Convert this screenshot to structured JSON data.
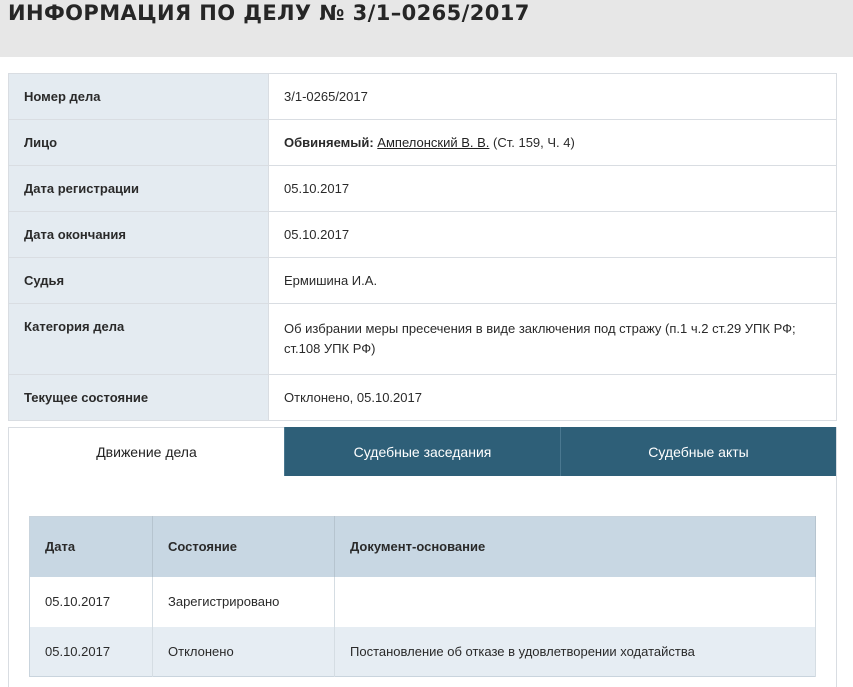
{
  "header": {
    "title": "Информация по делу № 3/1–0265/2017"
  },
  "case_info": {
    "rows": [
      {
        "label": "Номер дела",
        "value": "3/1-0265/2017"
      },
      {
        "label": "Лицо",
        "role": "Обвиняемый:",
        "name": "Ампелонский В. В.",
        "extra": "(Ст. 159, Ч. 4)"
      },
      {
        "label": "Дата регистрации",
        "value": "05.10.2017"
      },
      {
        "label": "Дата окончания",
        "value": "05.10.2017"
      },
      {
        "label": "Судья",
        "value": "Ермишина И.А."
      },
      {
        "label": "Категория дела",
        "value": "Об избрании меры пресечения в виде заключения под стражу (п.1 ч.2 ст.29 УПК РФ; ст.108 УПК РФ)"
      },
      {
        "label": "Текущее состояние",
        "value": "Отклонено, 05.10.2017"
      }
    ]
  },
  "tabs": [
    {
      "label": "Движение дела",
      "active": true
    },
    {
      "label": "Судебные заседания",
      "active": false
    },
    {
      "label": "Судебные акты",
      "active": false
    }
  ],
  "movements": {
    "columns": [
      "Дата",
      "Состояние",
      "Документ-основание"
    ],
    "rows": [
      {
        "date": "05.10.2017",
        "state": "Зарегистрировано",
        "doc": ""
      },
      {
        "date": "05.10.2017",
        "state": "Отклонено",
        "doc": "Постановление об отказе в удовлетворении ходатайства"
      }
    ]
  },
  "colors": {
    "tab_active_bg": "#ffffff",
    "tab_inactive_bg": "#2e5f78",
    "label_bg": "#e4ebf1",
    "table_head_bg": "#c8d7e3"
  }
}
